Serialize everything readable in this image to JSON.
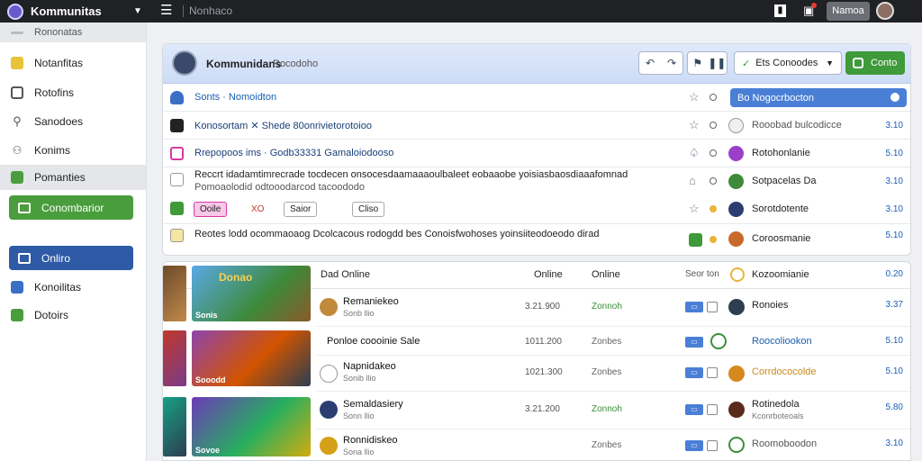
{
  "topbar": {
    "app_title": "Kommunitas",
    "menu_icon": "hamburger-icon",
    "search_text": "Nonhaco",
    "user_label": "Namoa"
  },
  "sidebar": {
    "top_label": "Rononatas",
    "items": [
      {
        "label": "Notanfitas",
        "icon": "note-icon",
        "color": "#e8c33a"
      },
      {
        "label": "Rotofins",
        "icon": "shield-icon",
        "color": "#555555"
      },
      {
        "label": "Sanodoes",
        "icon": "search-icon",
        "color": "#555555"
      },
      {
        "label": "Konims",
        "icon": "users-icon",
        "color": "#555555"
      },
      {
        "label": "Pomanties",
        "icon": "folder-icon",
        "color": "#4a9d3c"
      }
    ],
    "green_button": "Conombarior",
    "blue_button": "Onliro",
    "lower_items": [
      {
        "label": "Konoilitas",
        "icon": "puzzle-icon"
      },
      {
        "label": "Dotoirs",
        "icon": "chart-icon"
      }
    ]
  },
  "panel": {
    "title": "Kommunidans",
    "subtitle": "Rocodoho",
    "select_label": "Ets Conoodes",
    "green_label": "Conto",
    "rows": [
      {
        "text": "Sonts · Nomoidton",
        "right": "Bo Nogocrbocton",
        "num": ""
      },
      {
        "text": "Konosortam  ✕ Shede 80onrivietorotoioo",
        "right": "Rooobad bulcodicce",
        "num": "3.10"
      },
      {
        "text": "Rrepopoos ims · Godb33331 Gamaloiodooso",
        "right": "Rotohonlanie",
        "num": "5.10"
      },
      {
        "text": "Reccrt idadamtimrecrade tocdecen onsocesdaamaaaoulbaleet eobaaobe yoisiasbaosdiaaafomnad",
        "right": "Sotpacelas Da",
        "num": "3.10"
      },
      {
        "text": "Pomoaolodid odtooodarcod tacoododo",
        "right": "",
        "num": ""
      },
      {
        "text": "",
        "right": "Sorotdotente",
        "num": "3.10"
      },
      {
        "text": "Reotes lodd ocommaoaog Dcolcacous rodogdd bes Conoisfwohoses yoinsiiteodoeodo dirad",
        "right": "Coroosmanie",
        "num": "5.10"
      }
    ],
    "chips": [
      "Ooile",
      "XO",
      "Saior",
      "Cliso"
    ]
  },
  "list": {
    "headers": [
      "Dad Online",
      "Online",
      "Online",
      "Seor ton",
      "Kozoomianie",
      "0.20"
    ],
    "thumb_titles": [
      "Donao",
      "",
      ""
    ],
    "thumb_caps": [
      "Sonis",
      "Sooodd",
      "Sovoe"
    ],
    "rows": [
      {
        "t1": "Remaniekeo",
        "t2": "Sonb llio",
        "date": "3.21.900",
        "status": "Zonnoh",
        "status_color": "#3a8f3a",
        "name": "Ronoies",
        "num": "3.37"
      },
      {
        "t1": "Ponloe coooinie Sale",
        "t2": "",
        "date": "1011.200",
        "status": "Zonbes",
        "status_color": "#666666",
        "name": "Roocoliookon",
        "num": "5.10"
      },
      {
        "t1": "Napnidakeo",
        "t2": "Sonib llio",
        "date": "1021.300",
        "status": "Zonbes",
        "status_color": "#666666",
        "name": "Corrdococolde",
        "num": "5.10"
      },
      {
        "t1": "Semaldasiery",
        "t2": "Sonn llio",
        "date": "3.21.200",
        "status": "Zonnoh",
        "status_color": "#3a8f3a",
        "name": "Rotinedola",
        "num": "5.80"
      },
      {
        "t1": "Ronnidiskeo",
        "t2": "Sona llio",
        "date": "",
        "status": "Zonbes",
        "status_color": "#666666",
        "name": "Roomoboodon",
        "num": "3.10"
      }
    ],
    "row_names_sub": "Kconrboteoals"
  }
}
